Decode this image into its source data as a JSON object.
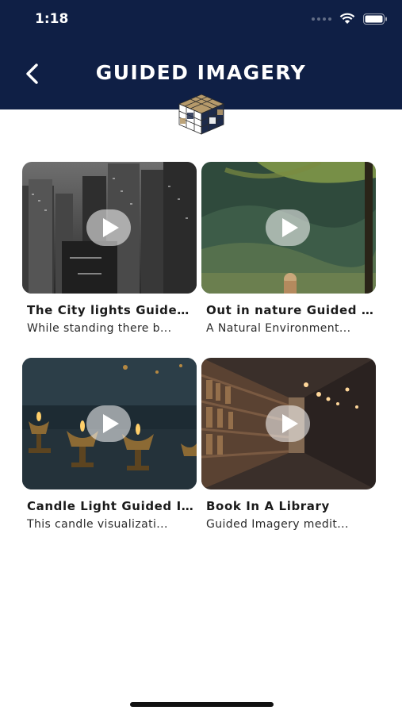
{
  "status_bar": {
    "time": "1:18"
  },
  "header": {
    "title": "GUIDED IMAGERY",
    "background": "#0f1f45"
  },
  "icons": {
    "back": "chevron-left-icon",
    "wifi": "wifi-icon",
    "battery": "battery-icon",
    "play": "play-icon"
  },
  "cards": [
    {
      "title": "The City lights Guided Imagery",
      "description": "While standing there b..."
    },
    {
      "title": "Out in nature Guided Imagery",
      "description": "A Natural Environment..."
    },
    {
      "title": "Candle Light Guided Imagery",
      "description": "This candle visualizati..."
    },
    {
      "title": "Book In A Library",
      "description": "Guided Imagery medit..."
    }
  ]
}
